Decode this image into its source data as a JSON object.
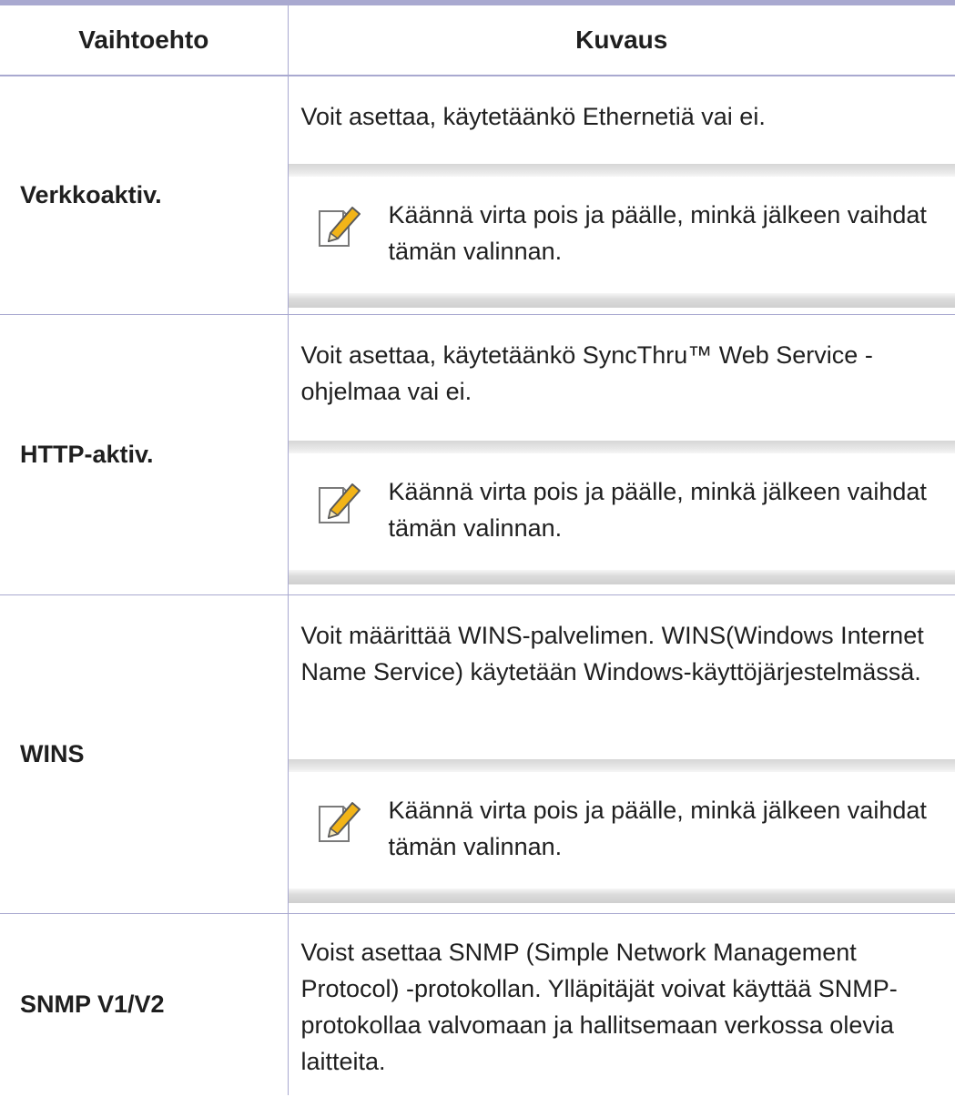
{
  "header": {
    "col1": "Vaihtoehto",
    "col2": "Kuvaus"
  },
  "note_icon": "note-pencil-icon",
  "rows": [
    {
      "name": "Verkkoaktiv.",
      "desc": "Voit asettaa, käytetäänkö Ethernetiä vai ei.",
      "note": "Käännä virta pois ja päälle, minkä jälkeen vaihdat tämän valinnan."
    },
    {
      "name": "HTTP-aktiv.",
      "desc": "Voit asettaa, käytetäänkö SyncThru™ Web Service -ohjelmaa vai ei.",
      "note": "Käännä virta pois ja päälle, minkä jälkeen vaihdat tämän valinnan."
    },
    {
      "name": "WINS",
      "desc": "Voit määrittää WINS-palvelimen. WINS(Windows Internet Name Service) käytetään Windows-käyttöjärjestelmässä.",
      "note": "Käännä virta pois ja päälle, minkä jälkeen vaihdat tämän valinnan."
    },
    {
      "name": "SNMP V1/V2",
      "desc": "Voist asettaa SNMP (Simple Network Management Protocol) -protokollan. Ylläpitäjät voivat käyttää SNMP-protokollaa valvomaan ja hallitsemaan verkossa olevia laitteita."
    }
  ]
}
